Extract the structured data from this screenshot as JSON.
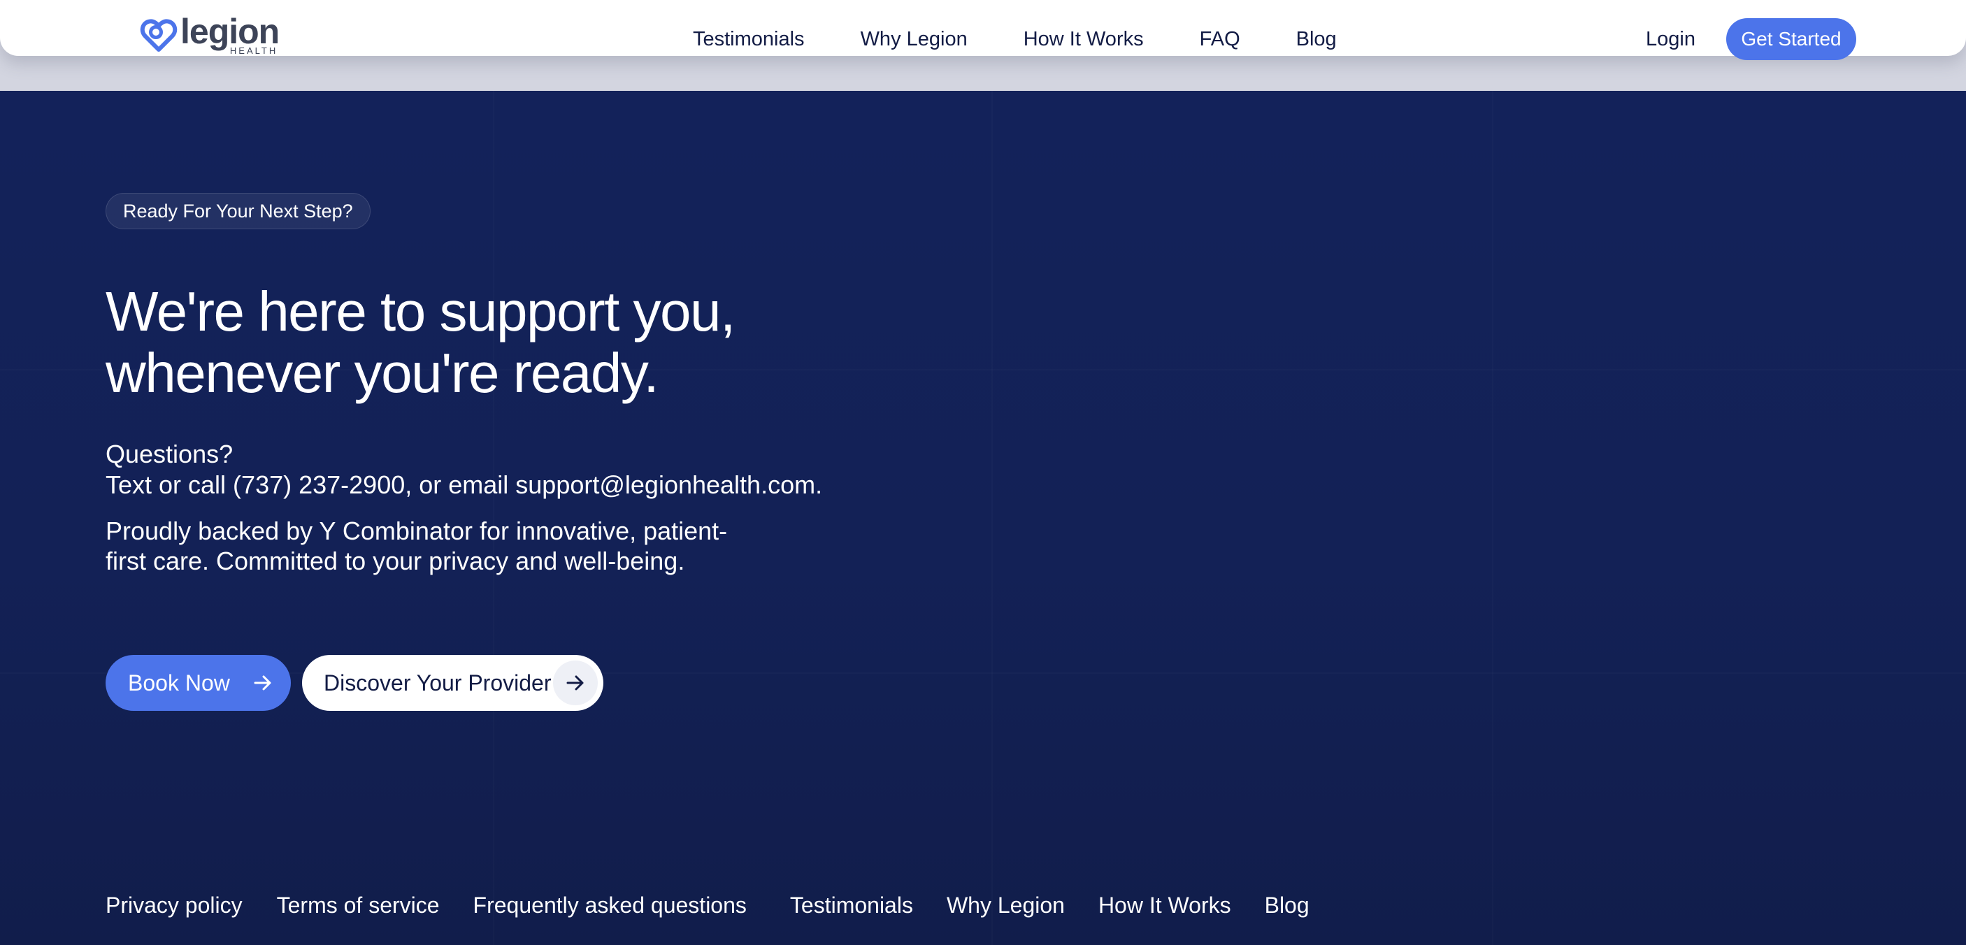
{
  "brand": {
    "name": "legion",
    "sub": "HEALTH",
    "color": "#4c74ea"
  },
  "nav": {
    "items": [
      {
        "label": "Testimonials"
      },
      {
        "label": "Why Legion"
      },
      {
        "label": "How It Works"
      },
      {
        "label": "FAQ"
      },
      {
        "label": "Blog"
      }
    ],
    "login_label": "Login",
    "cta_label": "Get Started"
  },
  "hero": {
    "eyebrow": "Ready For Your Next Step?",
    "headline_line1": "We're here to support you,",
    "headline_line2": "whenever you're ready.",
    "contact_line1": "Questions?",
    "contact_line2": "Text or call (737) 237-2900, or email support@legionhealth.com.",
    "backed_line1": "Proudly backed by Y Combinator for innovative, patient-",
    "backed_line2": "first care. Committed to your privacy and well-being.",
    "book_label": "Book Now",
    "book_icon": "arrow-right-icon",
    "discover_label": "Discover Your Provider",
    "discover_icon": "arrow-right-icon"
  },
  "footer": {
    "links": [
      {
        "label": "Privacy policy"
      },
      {
        "label": "Terms of service"
      },
      {
        "label": "Frequently asked questions"
      },
      {
        "label": "Testimonials"
      },
      {
        "label": "Why Legion"
      },
      {
        "label": "How It Works"
      },
      {
        "label": "Blog"
      }
    ]
  },
  "colors": {
    "background": "#132156",
    "accent": "#4c74ea",
    "header_bg": "#ffffff",
    "nav_text": "#131c45"
  }
}
